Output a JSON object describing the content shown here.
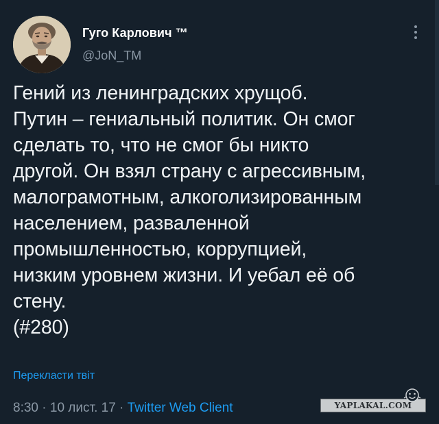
{
  "author": {
    "display_name": "Гуго Карлович ™",
    "handle": "@JoN_TM"
  },
  "tweet": {
    "lines": [
      "Гений из ленинградских хрущоб.",
      "Путин – гениальный политик. Он смог",
      "сделать то, что не смог бы никто",
      "другой. Он взял страну с агрессивным,",
      "малограмотным, алкоголизированным",
      "населением, разваленной",
      "промышленностью, коррупцией,",
      "низким уровнем жизни. И уебал её об",
      "стену.",
      "(#280)"
    ],
    "translate_label": "Перекласти твіт"
  },
  "meta": {
    "time": "8:30",
    "separator": " · ",
    "date": "10 лист. 17",
    "client": "Twitter Web Client"
  },
  "watermark": {
    "text": "YAPLAKAL.COM"
  },
  "icons": {
    "more": "more-vertical-icon",
    "avatar": "portrait-avatar",
    "watermark_face": "smiley-face-icon"
  },
  "colors": {
    "background": "#15202b",
    "text": "#f0f3f5",
    "secondary": "#8b98a5",
    "link": "#1d9bf0"
  }
}
